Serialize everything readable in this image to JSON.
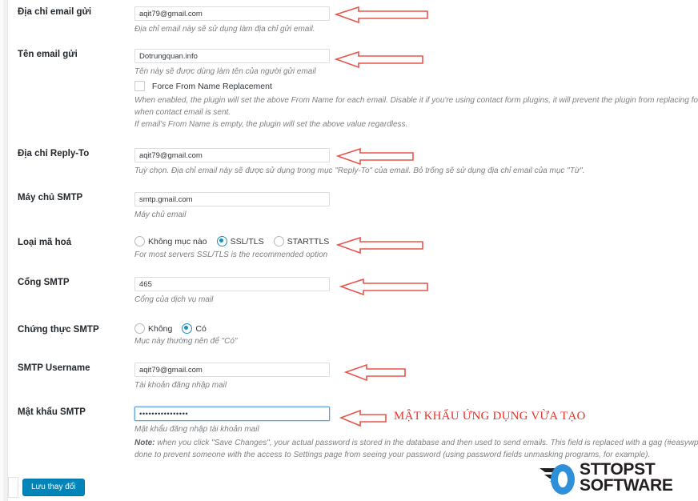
{
  "form": {
    "rows": [
      {
        "id": "from-email",
        "label": "Địa chỉ email gửi",
        "value": "aqit79@gmail.com",
        "help": "Địa chỉ email này sẽ sử dụng làm địa chỉ gửi email."
      },
      {
        "id": "from-name",
        "label": "Tên email gửi",
        "value": "Dotrungquan.info",
        "help": "Tên này sẽ được dùng làm tên của người gửi email",
        "checkbox_label": "Force From Name Replacement",
        "help2": "When enabled, the plugin will set the above From Name for each email. Disable it if you're using contact form plugins, it will prevent the plugin from replacing form subm",
        "help3": "when contact email is sent.",
        "help4": "If email's From Name is empty, the plugin will set the above value regardless."
      },
      {
        "id": "reply-to",
        "label": "Địa chỉ Reply-To",
        "value": "aqit79@gmail.com",
        "help": "Tuỳ chọn. Địa chỉ email này sẽ được sử dụng trong mục \"Reply-To\" của email. Bỏ trống sẽ sử dụng địa chỉ email của mục \"Từ\"."
      },
      {
        "id": "smtp-host",
        "label": "Máy chủ SMTP",
        "value": "smtp.gmail.com",
        "help": "Máy chủ email"
      },
      {
        "id": "encryption",
        "label": "Loại mã hoá",
        "options": [
          {
            "label": "Không mục nào",
            "selected": false
          },
          {
            "label": "SSL/TLS",
            "selected": true
          },
          {
            "label": "STARTTLS",
            "selected": false
          }
        ],
        "help": "For most servers SSL/TLS is the recommended option"
      },
      {
        "id": "smtp-port",
        "label": "Cổng SMTP",
        "value": "465",
        "help": "Cổng của dịch vụ mail"
      },
      {
        "id": "smtp-auth",
        "label": "Chứng thực SMTP",
        "options": [
          {
            "label": "Không",
            "selected": false
          },
          {
            "label": "Có",
            "selected": true
          }
        ],
        "help": "Mục này thường nên để \"Có\""
      },
      {
        "id": "smtp-username",
        "label": "SMTP Username",
        "value": "aqit79@gmail.com",
        "help": "Tài khoản đăng nhập mail"
      },
      {
        "id": "smtp-password",
        "label": "Mật khẩu SMTP",
        "value": "••••••••••••••••",
        "help": "Mật khẩu đăng nhập tài khoản mail",
        "note_bold": "Note:",
        "note": " when you click \"Save Changes\", your actual password is stored in the database and then used to send emails. This field is replaced with a gag (#easywpsmtpgagpas",
        "note2": "done to prevent someone with the access to Settings page from seeing your password (using password fields unmasking programs, for example)."
      }
    ],
    "save_label": "Lưu thay đổi"
  },
  "annotations": {
    "password_note": "MẬT KHẨU ỨNG DỤNG VỪA TẠO",
    "arrow_color": "#e8554a"
  },
  "watermark": {
    "line1": "STTOPST",
    "line2": "SOFTWARE",
    "accent_color": "#2f8fd8"
  }
}
